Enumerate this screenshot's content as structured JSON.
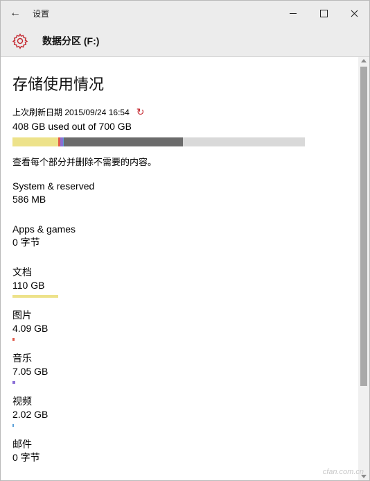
{
  "titlebar": {
    "title": "设置",
    "back_glyph": "←"
  },
  "header": {
    "title": "数据分区 (F:)",
    "icon": "gear-icon",
    "icon_color": "#c4262e"
  },
  "main": {
    "page_title": "存储使用情况",
    "refresh_text": "上次刷新日期 2015/09/24 16:54",
    "used_text": "408 GB used out of 700 GB",
    "hint": "查看每个部分并删除不需要的内容。",
    "storage_bar": {
      "track_color": "#d9d9d9",
      "segments": [
        {
          "fraction": 0.157,
          "color": "#ede28a"
        },
        {
          "fraction": 0.006,
          "color": "#e05a4b"
        },
        {
          "fraction": 0.01,
          "color": "#8a6fd6"
        },
        {
          "fraction": 0.003,
          "color": "#5aa0d8"
        },
        {
          "fraction": 0.407,
          "color": "#6b6b6b"
        }
      ]
    },
    "categories": [
      {
        "name": "System & reserved",
        "size": "586 MB",
        "bar_fraction": 0,
        "color": "#999999"
      },
      {
        "name": "Apps & games",
        "size": "0 字节",
        "bar_fraction": 0,
        "color": "#999999"
      },
      {
        "name": "文档",
        "size": "110 GB",
        "bar_fraction": 0.157,
        "color": "#ede28a"
      },
      {
        "name": "图片",
        "size": "4.09 GB",
        "bar_fraction": 0.006,
        "color": "#e05a4b"
      },
      {
        "name": "音乐",
        "size": "7.05 GB",
        "bar_fraction": 0.01,
        "color": "#8a6fd6"
      },
      {
        "name": "视频",
        "size": "2.02 GB",
        "bar_fraction": 0.003,
        "color": "#5aa0d8"
      },
      {
        "name": "邮件",
        "size": "0 字节",
        "bar_fraction": 0,
        "color": "#999999"
      }
    ]
  },
  "watermark": "cfan.com.cn"
}
